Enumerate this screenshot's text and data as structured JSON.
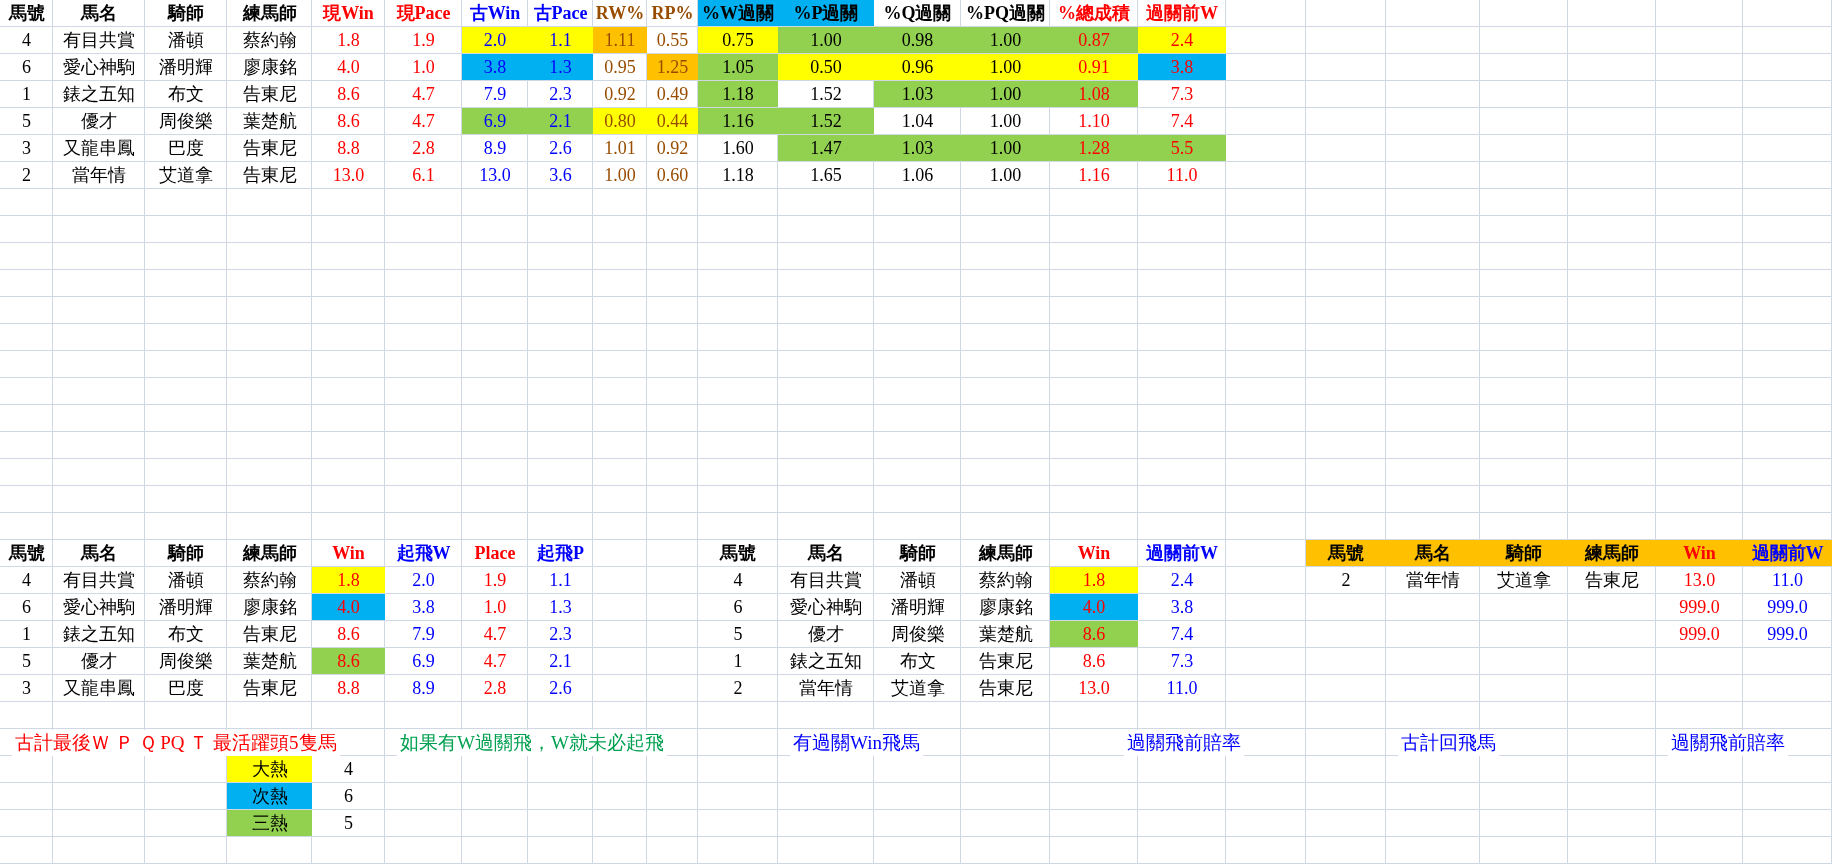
{
  "top_table": {
    "columns": [
      {
        "label": "馬號",
        "color": "#000000"
      },
      {
        "label": "馬名",
        "color": "#000000"
      },
      {
        "label": "騎師",
        "color": "#000000"
      },
      {
        "label": "練馬師",
        "color": "#000000"
      },
      {
        "label": "現Win",
        "color": "#ff0000"
      },
      {
        "label": "現Pace",
        "color": "#ff0000"
      },
      {
        "label": "古Win",
        "color": "#0000ff"
      },
      {
        "label": "古Pace",
        "color": "#0000ff"
      },
      {
        "label": "RW%",
        "color": "#994c00"
      },
      {
        "label": "RP%",
        "color": "#994c00"
      },
      {
        "label": "%W過關",
        "color": "#000000",
        "header_fill": {
          "color": "#00b0f0"
        }
      },
      {
        "label": "%P過關",
        "color": "#000000",
        "header_fill": {
          "color": "#00b0f0"
        }
      },
      {
        "label": "%Q過關",
        "color": "#000000"
      },
      {
        "label": "%PQ過關",
        "color": "#000000"
      },
      {
        "label": "%總成積",
        "color": "#ff0000"
      },
      {
        "label": "過關前W",
        "color": "#ff0000"
      }
    ],
    "rows": [
      {
        "cells": [
          "4",
          "有目共賞",
          "潘頓",
          "蔡約翰",
          "1.8",
          "1.9",
          {
            "text": "2.0",
            "color": "#ffff00"
          },
          {
            "text": "1.1",
            "color": "#ffff00"
          },
          {
            "text": "1.11",
            "color": "#ffc000"
          },
          "0.55",
          {
            "text": "0.75",
            "color": "#ffff00"
          },
          {
            "text": "1.00",
            "color": "#92d050"
          },
          {
            "text": "0.98",
            "color": "#92d050"
          },
          {
            "text": "1.00",
            "color": "#92d050"
          },
          {
            "text": "0.87",
            "color": "#92d050"
          },
          {
            "text": "2.4",
            "color": "#ffff00"
          }
        ]
      },
      {
        "cells": [
          "6",
          "愛心神駒",
          "潘明輝",
          "廖康銘",
          "4.0",
          "1.0",
          {
            "text": "3.8",
            "color": "#00b0f0"
          },
          {
            "text": "1.3",
            "color": "#00b0f0"
          },
          "0.95",
          {
            "text": "1.25",
            "color": "#ffc000"
          },
          {
            "text": "1.05",
            "color": "#92d050"
          },
          {
            "text": "0.50",
            "color": "#ffff00"
          },
          {
            "text": "0.96",
            "color": "#ffff00"
          },
          {
            "text": "1.00",
            "color": "#ffff00"
          },
          {
            "text": "0.91",
            "color": "#ffff00"
          },
          {
            "text": "3.8",
            "color": "#00b0f0"
          }
        ]
      },
      {
        "cells": [
          "1",
          "錶之五知",
          "布文",
          "告東尼",
          "8.6",
          "4.7",
          "7.9",
          "2.3",
          "0.92",
          "0.49",
          {
            "text": "1.18",
            "color": "#92d050"
          },
          "1.52",
          {
            "text": "1.03",
            "color": "#92d050"
          },
          {
            "text": "1.00",
            "color": "#92d050"
          },
          {
            "text": "1.08",
            "color": "#92d050"
          },
          "7.3"
        ]
      },
      {
        "cells": [
          "5",
          "優才",
          "周俊樂",
          "葉楚航",
          "8.6",
          "4.7",
          {
            "text": "6.9",
            "color": "#92d050"
          },
          {
            "text": "2.1",
            "color": "#92d050"
          },
          {
            "text": "0.80",
            "color": "#ffff00"
          },
          {
            "text": "0.44",
            "color": "#ffff00"
          },
          {
            "text": "1.16",
            "color": "#92d050"
          },
          {
            "text": "1.52",
            "color": "#92d050"
          },
          "1.04",
          "1.00",
          "1.10",
          "7.4"
        ]
      },
      {
        "cells": [
          "3",
          "又龍串鳳",
          "巴度",
          "告東尼",
          "8.8",
          "2.8",
          "8.9",
          "2.6",
          "1.01",
          "0.92",
          "1.60",
          {
            "text": "1.47",
            "color": "#92d050"
          },
          {
            "text": "1.03",
            "color": "#92d050"
          },
          {
            "text": "1.00",
            "color": "#92d050"
          },
          {
            "text": "1.28",
            "color": "#92d050"
          },
          {
            "text": "5.5",
            "color": "#92d050"
          }
        ]
      },
      {
        "cells": [
          "2",
          "當年情",
          "艾道拿",
          "告東尼",
          "13.0",
          "6.1",
          "13.0",
          "3.6",
          "1.00",
          "0.60",
          "1.18",
          "1.65",
          "1.06",
          "1.00",
          "1.16",
          "11.0"
        ]
      }
    ]
  },
  "takeoff_table": {
    "columns": [
      {
        "label": "馬號",
        "color": "#000000"
      },
      {
        "label": "馬名",
        "color": "#000000"
      },
      {
        "label": "騎師",
        "color": "#000000"
      },
      {
        "label": "練馬師",
        "color": "#000000"
      },
      {
        "label": "Win",
        "color": "#ff0000"
      },
      {
        "label": "起飛W",
        "color": "#0000ff"
      },
      {
        "label": "Place",
        "color": "#ff0000"
      },
      {
        "label": "起飛P",
        "color": "#0000ff"
      }
    ],
    "rows": [
      {
        "cells": [
          "4",
          "有目共賞",
          "潘頓",
          "蔡約翰",
          {
            "text": "1.8",
            "color": "#ffff00"
          },
          "2.0",
          "1.9",
          "1.1"
        ]
      },
      {
        "cells": [
          "6",
          "愛心神駒",
          "潘明輝",
          "廖康銘",
          {
            "text": "4.0",
            "color": "#00b0f0"
          },
          "3.8",
          "1.0",
          "1.3"
        ]
      },
      {
        "cells": [
          "1",
          "錶之五知",
          "布文",
          "告東尼",
          "8.6",
          "7.9",
          "4.7",
          "2.3"
        ]
      },
      {
        "cells": [
          "5",
          "優才",
          "周俊樂",
          "葉楚航",
          {
            "text": "8.6",
            "color": "#92d050"
          },
          "6.9",
          "4.7",
          "2.1"
        ]
      },
      {
        "cells": [
          "3",
          "又龍串鳳",
          "巴度",
          "告東尼",
          "8.8",
          "8.9",
          "2.8",
          "2.6"
        ]
      }
    ]
  },
  "parlay_table": {
    "columns": [
      {
        "label": "馬號",
        "color": "#000000"
      },
      {
        "label": "馬名",
        "color": "#000000"
      },
      {
        "label": "騎師",
        "color": "#000000"
      },
      {
        "label": "練馬師",
        "color": "#000000"
      },
      {
        "label": "Win",
        "color": "#ff0000"
      },
      {
        "label": "過關前W",
        "color": "#0000ff"
      }
    ],
    "rows": [
      {
        "cells": [
          "4",
          "有目共賞",
          "潘頓",
          "蔡約翰",
          {
            "text": "1.8",
            "color": "#ffff00"
          },
          "2.4"
        ]
      },
      {
        "cells": [
          "6",
          "愛心神駒",
          "潘明輝",
          "廖康銘",
          {
            "text": "4.0",
            "color": "#00b0f0"
          },
          "3.8"
        ]
      },
      {
        "cells": [
          "5",
          "優才",
          "周俊樂",
          "葉楚航",
          {
            "text": "8.6",
            "color": "#92d050"
          },
          "7.4"
        ]
      },
      {
        "cells": [
          "1",
          "錶之五知",
          "布文",
          "告東尼",
          "8.6",
          "7.3"
        ]
      },
      {
        "cells": [
          "2",
          "當年情",
          "艾道拿",
          "告東尼",
          "13.0",
          "11.0"
        ]
      }
    ]
  },
  "return_table": {
    "header_fill": {
      "color": "#ffc000"
    },
    "columns": [
      {
        "label": "馬號",
        "color": "#000000"
      },
      {
        "label": "馬名",
        "color": "#000000"
      },
      {
        "label": "騎師",
        "color": "#000000"
      },
      {
        "label": "練馬師",
        "color": "#000000"
      },
      {
        "label": "Win",
        "color": "#ff0000"
      },
      {
        "label": "過關前W",
        "color": "#0000ff"
      }
    ],
    "rows": [
      {
        "cells": [
          "2",
          "當年情",
          "艾道拿",
          "告東尼",
          "13.0",
          "11.0"
        ]
      },
      {
        "cells": [
          null,
          null,
          null,
          null,
          "999.0",
          "999.0"
        ]
      },
      {
        "cells": [
          null,
          null,
          null,
          null,
          "999.0",
          "999.0"
        ]
      }
    ]
  },
  "notes": [
    {
      "text": "古計最後Ｗ Ｐ Ｑ PQ Ｔ 最活躍頭5隻馬",
      "color": "#ff0000"
    },
    {
      "text": "如果有W過關飛，W就未必起飛",
      "color": "#00a050"
    },
    {
      "text": "有過關Win飛馬",
      "color": "#0000ff"
    },
    {
      "text": "過關飛前賠率",
      "color": "#0000ff"
    },
    {
      "text": "古計回飛馬",
      "color": "#0000ff"
    },
    {
      "text": "過關飛前賠率",
      "color": "#0000ff"
    }
  ],
  "legend": [
    {
      "label": "大熱",
      "color": "#ffff00",
      "value": "4"
    },
    {
      "label": "次熱",
      "color": "#00b0f0",
      "value": "6"
    },
    {
      "label": "三熱",
      "color": "#92d050",
      "value": "5"
    }
  ]
}
